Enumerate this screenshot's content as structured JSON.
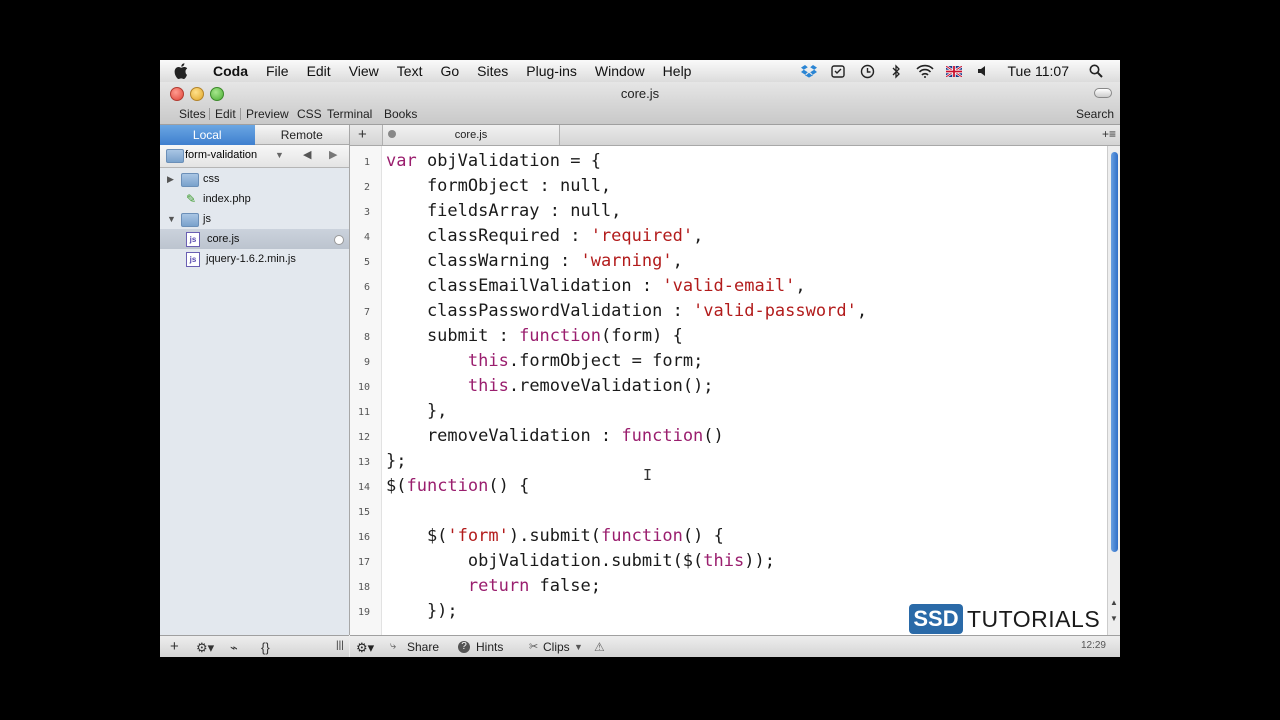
{
  "menubar": {
    "app_name": "Coda",
    "items": [
      "File",
      "Edit",
      "View",
      "Text",
      "Go",
      "Sites",
      "Plug-ins",
      "Window",
      "Help"
    ],
    "clock": "Tue 11:07"
  },
  "window": {
    "title": "core.js"
  },
  "toolbar": {
    "items": [
      "Sites",
      "Edit",
      "Preview",
      "CSS",
      "Terminal",
      "Books"
    ],
    "search_label": "Search"
  },
  "sidebar": {
    "segments": [
      "Local",
      "Remote"
    ],
    "site_name": "form-validation",
    "tree": [
      {
        "label": "css"
      },
      {
        "label": "index.php"
      },
      {
        "label": "js"
      },
      {
        "label": "core.js"
      },
      {
        "label": "jquery-1.6.2.min.js"
      }
    ]
  },
  "editor": {
    "tab_label": "core.js",
    "lines": [
      {
        "n": "1",
        "code": "var objValidation = {"
      },
      {
        "n": "2",
        "code": "    formObject : null,"
      },
      {
        "n": "3",
        "code": "    fieldsArray : null,"
      },
      {
        "n": "4",
        "code": "    classRequired : 'required',"
      },
      {
        "n": "5",
        "code": "    classWarning : 'warning',"
      },
      {
        "n": "6",
        "code": "    classEmailValidation : 'valid-email',"
      },
      {
        "n": "7",
        "code": "    classPasswordValidation : 'valid-password',"
      },
      {
        "n": "8",
        "code": "    submit : function(form) {"
      },
      {
        "n": "9",
        "code": "        this.formObject = form;"
      },
      {
        "n": "10",
        "code": "        this.removeValidation();"
      },
      {
        "n": "11",
        "code": "    },"
      },
      {
        "n": "12",
        "code": "    removeValidation : function()"
      },
      {
        "n": "13",
        "code": "};"
      },
      {
        "n": "14",
        "code": "$(function() {"
      },
      {
        "n": "15",
        "code": ""
      },
      {
        "n": "16",
        "code": "    $('form').submit(function() {"
      },
      {
        "n": "17",
        "code": "        objValidation.submit($(this));"
      },
      {
        "n": "18",
        "code": "        return false;"
      },
      {
        "n": "19",
        "code": "    });"
      }
    ]
  },
  "bottombar": {
    "share": "Share",
    "hints": "Hints",
    "clips": "Clips",
    "cursor_pos": "12:29"
  },
  "watermark": {
    "brand": "SSD",
    "text": "TUTORIALS"
  },
  "colors": {
    "keyword": "#9a1e6e",
    "string": "#b21b1b",
    "selection_blue": "#3f7fcf",
    "watermark_blue": "#2a6aa8"
  },
  "icons": [
    "apple-icon",
    "dropbox-icon",
    "time-machine-icon",
    "bluetooth-icon",
    "wifi-icon",
    "uk-flag-icon",
    "volume-icon",
    "spotlight-icon",
    "gear-icon",
    "plus-icon",
    "warning-icon",
    "help-icon"
  ]
}
